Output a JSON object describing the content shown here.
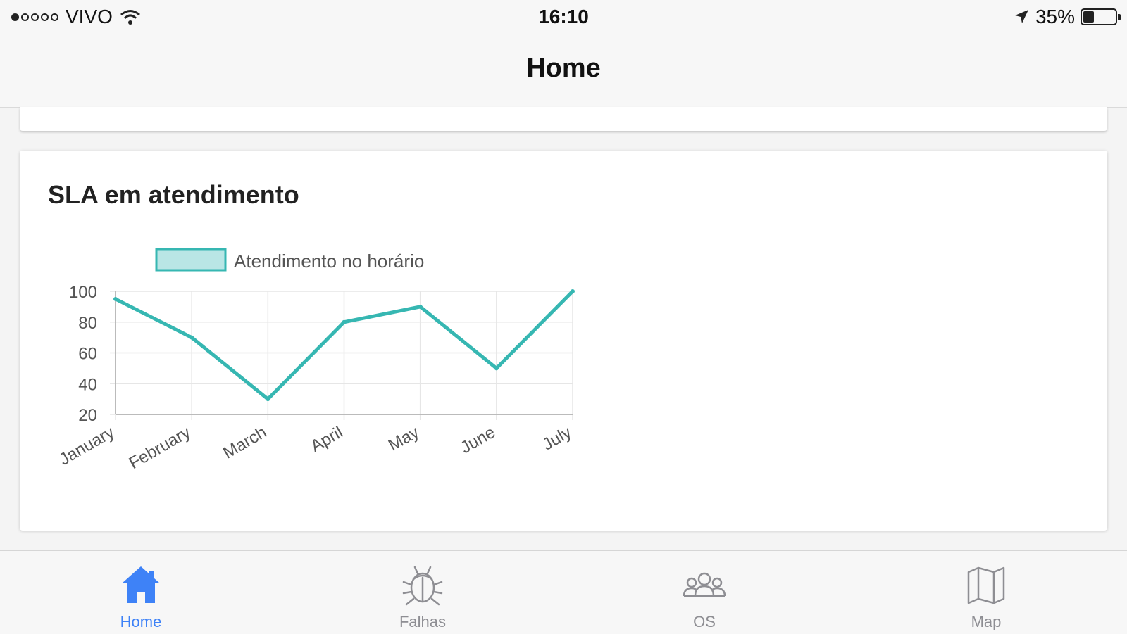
{
  "status_bar": {
    "carrier": "VIVO",
    "signal_bars_filled": 1,
    "signal_bars_total": 5,
    "time": "16:10",
    "battery_percent": "35%",
    "battery_level": 0.35
  },
  "nav": {
    "title": "Home"
  },
  "card": {
    "title": "SLA em atendimento"
  },
  "chart_data": {
    "type": "line",
    "categories": [
      "January",
      "February",
      "March",
      "April",
      "May",
      "June",
      "July"
    ],
    "series": [
      {
        "name": "Atendimento no horário",
        "values": [
          95,
          70,
          30,
          80,
          90,
          50,
          100
        ],
        "color": "#36b7b2",
        "fill": "#b9e6e5"
      }
    ],
    "y_ticks": [
      "100",
      "80",
      "60",
      "40",
      "20"
    ],
    "ylim": [
      20,
      100
    ],
    "grid": true,
    "legend_position": "top"
  },
  "tabs": [
    {
      "label": "Home",
      "icon": "home-icon",
      "active": true
    },
    {
      "label": "Falhas",
      "icon": "bug-icon",
      "active": false
    },
    {
      "label": "OS",
      "icon": "group-icon",
      "active": false
    },
    {
      "label": "Map",
      "icon": "map-icon",
      "active": false
    }
  ],
  "colors": {
    "accent": "#3e82f7",
    "inactive": "#8e8e93",
    "series": "#36b7b2"
  }
}
